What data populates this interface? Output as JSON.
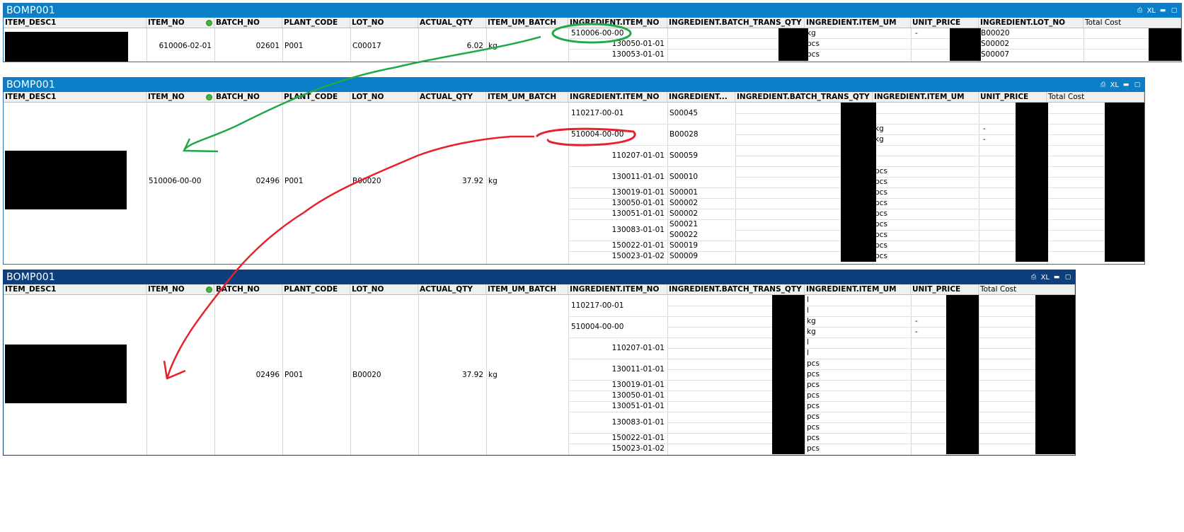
{
  "colors": {
    "title_bar_active": "#0a7fc8",
    "title_bar_selected": "#0d3f7f",
    "green_arrow": "#21a84a",
    "red_arrow": "#e8202a"
  },
  "icons": [
    "print-icon",
    "xl-export-icon",
    "minimize-icon",
    "maximize-icon",
    "selection-indicator-dot"
  ],
  "window_buttons": {
    "xl": "XL",
    "minimize": "▬",
    "maximize": "▢",
    "print": "⎙"
  },
  "panel1": {
    "title": "BOMP001",
    "headers": [
      "ITEM_DESC1",
      "ITEM_NO",
      "BATCH_NO",
      "PLANT_CODE",
      "LOT_NO",
      "ACTUAL_QTY",
      "ITEM_UM_BATCH",
      "INGREDIENT.ITEM_NO",
      "INGREDIENT.BATCH_TRANS_QTY",
      "INGREDIENT.ITEM_UM",
      "UNIT_PRICE",
      "INGREDIENT.LOT_NO",
      "Total Cost"
    ],
    "item_no": "610006-02-01",
    "batch_no": "02601",
    "plant_code": "P001",
    "lot_no": "C00017",
    "actual_qty": "6.02",
    "item_um_batch": "kg",
    "ingredients": [
      {
        "item_no": "510006-00-00",
        "um": "kg",
        "unit_price": "-",
        "lot_no": "B00020"
      },
      {
        "item_no": "130050-01-01",
        "um": "pcs",
        "unit_price": "",
        "lot_no": "S00002"
      },
      {
        "item_no": "130053-01-01",
        "um": "pcs",
        "unit_price": "",
        "lot_no": "S00007"
      }
    ]
  },
  "panel2": {
    "title": "BOMP001",
    "headers": [
      "ITEM_DESC1",
      "ITEM_NO",
      "BATCH_NO",
      "PLANT_CODE",
      "LOT_NO",
      "ACTUAL_QTY",
      "ITEM_UM_BATCH",
      "INGREDIENT.ITEM_NO",
      "INGREDIENT...",
      "INGREDIENT.BATCH_TRANS_QTY",
      "INGREDIENT.ITEM_UM",
      "UNIT_PRICE",
      "Total Cost"
    ],
    "item_no": "510006-00-00",
    "batch_no": "02496",
    "plant_code": "P001",
    "lot_no": "B00020",
    "actual_qty": "37.92",
    "item_um_batch": "kg",
    "ingredient_items": [
      "110217-00-01",
      "510004-00-00",
      "110207-01-01",
      "130011-01-01",
      "130019-01-01",
      "130050-01-01",
      "130051-01-01",
      "130083-01-01",
      "150022-01-01",
      "150023-01-02"
    ],
    "ingredient_lots": [
      "S00045",
      "B00028",
      "S00059",
      "S00010",
      "S00001",
      "S00002",
      "S00002",
      "S00021",
      "S00022",
      "S00019",
      "S00009"
    ],
    "um_rows": [
      "l",
      "l",
      "kg",
      "kg",
      "l",
      "l",
      "pcs",
      "pcs",
      "pcs",
      "pcs",
      "pcs",
      "pcs",
      "pcs",
      "pcs",
      "pcs"
    ],
    "price_rows": [
      "-",
      "-"
    ]
  },
  "panel3": {
    "title": "BOMP001",
    "headers": [
      "ITEM_DESC1",
      "ITEM_NO",
      "BATCH_NO",
      "PLANT_CODE",
      "LOT_NO",
      "ACTUAL_QTY",
      "ITEM_UM_BATCH",
      "INGREDIENT.ITEM_NO",
      "INGREDIENT.BATCH_TRANS_QTY",
      "INGREDIENT.ITEM_UM",
      "UNIT_PRICE",
      "Total Cost"
    ],
    "batch_no": "02496",
    "plant_code": "P001",
    "lot_no": "B00020",
    "actual_qty": "37.92",
    "item_um_batch": "kg",
    "ingredient_items": [
      "110217-00-01",
      "510004-00-00",
      "110207-01-01",
      "130011-01-01",
      "130019-01-01",
      "130050-01-01",
      "130051-01-01",
      "130083-01-01",
      "150022-01-01",
      "150023-01-02"
    ],
    "um_rows": [
      "l",
      "l",
      "kg",
      "kg",
      "l",
      "l",
      "pcs",
      "pcs",
      "pcs",
      "pcs",
      "pcs",
      "pcs",
      "pcs",
      "pcs",
      "pcs"
    ],
    "price_rows": [
      "-",
      "-"
    ]
  }
}
